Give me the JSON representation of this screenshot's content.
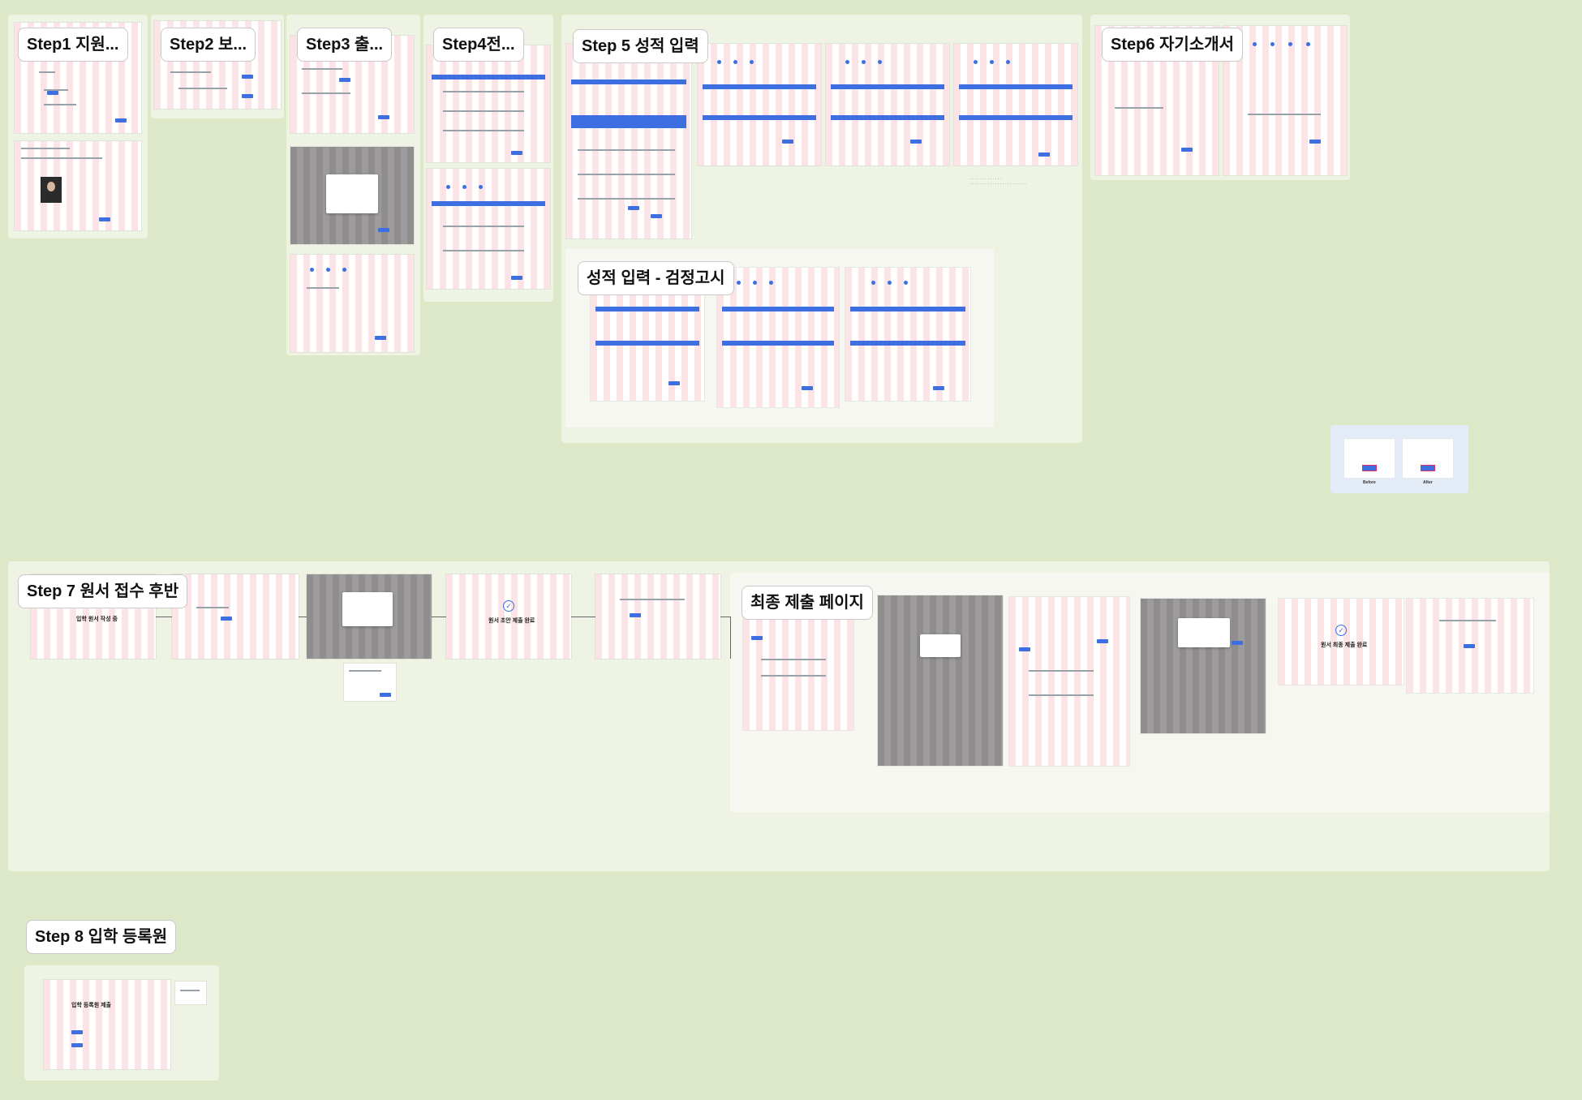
{
  "sections": {
    "step1": "Step1 지원...",
    "step2": "Step2 보...",
    "step3": "Step3 출...",
    "step4": "Step4전...",
    "step5": "Step 5 성적 입력",
    "step5_sub": "성적 입력 - 검정고시",
    "step6": "Step6 자기소개서",
    "step7": "Step 7 원서 접수 후반",
    "final_submit": "최종 제출 페이지",
    "step8": "Step 8 입학 등록원"
  },
  "frame_texts": {
    "writing_in_progress": "입학 원서 작성 중",
    "draft_complete": "원서 초안 제출 완료",
    "final_complete": "원서 최종 제출 완료",
    "registration": "입학 등록원 제출"
  },
  "before_after": [
    "Before",
    "After"
  ],
  "colors": {
    "canvas": "#dde8c8",
    "section": "#eef3e4",
    "accent": "#3d6fe0",
    "grid_pink": "#fbe3e6",
    "dark_overlay": "#8f8d8d"
  }
}
